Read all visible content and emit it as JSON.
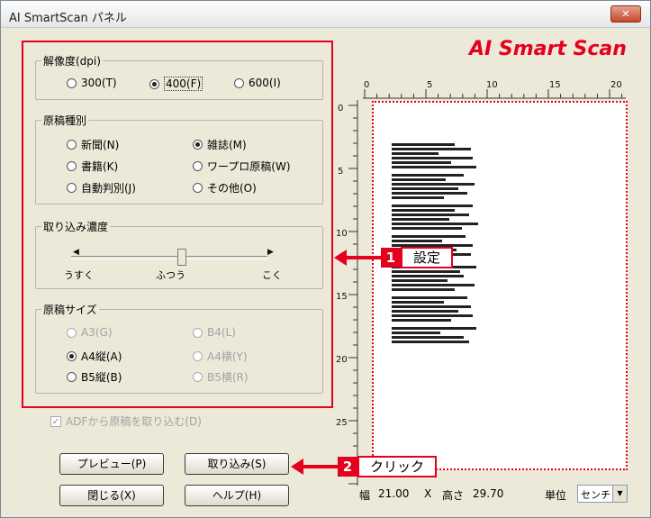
{
  "window": {
    "title": "AI SmartScan パネル",
    "close_glyph": "✕"
  },
  "logo": {
    "text_part1": "AI S",
    "text_part2": "mart S",
    "text_part3": "can"
  },
  "resolution": {
    "title": "解像度(dpi)",
    "options": [
      "300(T)",
      "400(F)",
      "600(I)"
    ],
    "selected": "400(F)"
  },
  "doc_type": {
    "title": "原稿種別",
    "options": [
      "新聞(N)",
      "雑誌(M)",
      "書籍(K)",
      "ワープロ原稿(W)",
      "自動判別(J)",
      "その他(O)"
    ],
    "selected": "雑誌(M)"
  },
  "density": {
    "title": "取り込み濃度",
    "label_light": "うすく",
    "label_normal": "ふつう",
    "label_dark": "こく",
    "left_arrow": "◀",
    "right_arrow": "▶",
    "level": 0.5
  },
  "size": {
    "title": "原稿サイズ",
    "options": [
      "A3(G)",
      "B4(L)",
      "A4縦(A)",
      "A4横(Y)",
      "B5縦(B)",
      "B5横(R)"
    ],
    "selected": "A4縦(A)"
  },
  "adf": {
    "label": "ADFから原稿を取り込む(D)",
    "checked": true,
    "check_glyph": "✓"
  },
  "buttons": {
    "preview": "プレビュー(P)",
    "scan": "取り込み(S)",
    "close": "閉じる(X)",
    "help": "ヘルプ(H)"
  },
  "ruler": {
    "h_labels": [
      "0",
      "5",
      "10",
      "15",
      "20"
    ],
    "v_labels": [
      "0",
      "5",
      "10",
      "15",
      "20",
      "25"
    ]
  },
  "callouts": [
    {
      "num": "1",
      "text": "設定"
    },
    {
      "num": "2",
      "text": "クリック"
    }
  ],
  "status": {
    "width_label": "幅",
    "width_value": "21.00",
    "times": "X",
    "height_label": "高さ",
    "height_value": "29.70",
    "unit_label": "単位",
    "unit_value": "センチ",
    "dropdown_glyph": "▼"
  }
}
